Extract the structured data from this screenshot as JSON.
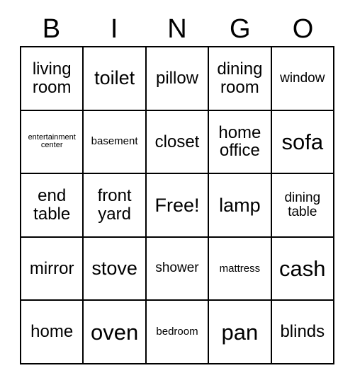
{
  "card": {
    "type": "bingo-card",
    "columns": 5,
    "rows": 5,
    "border_color": "#000000",
    "background_color": "#ffffff",
    "text_color": "#000000"
  },
  "header": {
    "letters": [
      {
        "label": "B"
      },
      {
        "label": "I"
      },
      {
        "label": "N"
      },
      {
        "label": "G"
      },
      {
        "label": "O"
      }
    ]
  },
  "grid": {
    "rows": [
      {
        "cells": [
          {
            "text": "living\nroom",
            "size": "md",
            "free": false
          },
          {
            "text": "toilet",
            "size": "lg",
            "free": false
          },
          {
            "text": "pillow",
            "size": "md",
            "free": false
          },
          {
            "text": "dining\nroom",
            "size": "md",
            "free": false
          },
          {
            "text": "window",
            "size": "sm",
            "free": false
          }
        ]
      },
      {
        "cells": [
          {
            "text": "entertainment\ncenter",
            "size": "xxs",
            "free": false
          },
          {
            "text": "basement",
            "size": "xs",
            "free": false
          },
          {
            "text": "closet",
            "size": "md",
            "free": false
          },
          {
            "text": "home\noffice",
            "size": "md",
            "free": false
          },
          {
            "text": "sofa",
            "size": "xl",
            "free": false
          }
        ]
      },
      {
        "cells": [
          {
            "text": "end\ntable",
            "size": "md",
            "free": false
          },
          {
            "text": "front\nyard",
            "size": "md",
            "free": false
          },
          {
            "text": "Free!",
            "size": "lg",
            "free": true
          },
          {
            "text": "lamp",
            "size": "lg",
            "free": false
          },
          {
            "text": "dining\ntable",
            "size": "sm",
            "free": false
          }
        ]
      },
      {
        "cells": [
          {
            "text": "mirror",
            "size": "md",
            "free": false
          },
          {
            "text": "stove",
            "size": "lg",
            "free": false
          },
          {
            "text": "shower",
            "size": "sm",
            "free": false
          },
          {
            "text": "mattress",
            "size": "xs",
            "free": false
          },
          {
            "text": "cash",
            "size": "xl",
            "free": false
          }
        ]
      },
      {
        "cells": [
          {
            "text": "home",
            "size": "md",
            "free": false
          },
          {
            "text": "oven",
            "size": "xl",
            "free": false
          },
          {
            "text": "bedroom",
            "size": "xs",
            "free": false
          },
          {
            "text": "pan",
            "size": "xl",
            "free": false
          },
          {
            "text": "blinds",
            "size": "md",
            "free": false
          }
        ]
      }
    ]
  }
}
